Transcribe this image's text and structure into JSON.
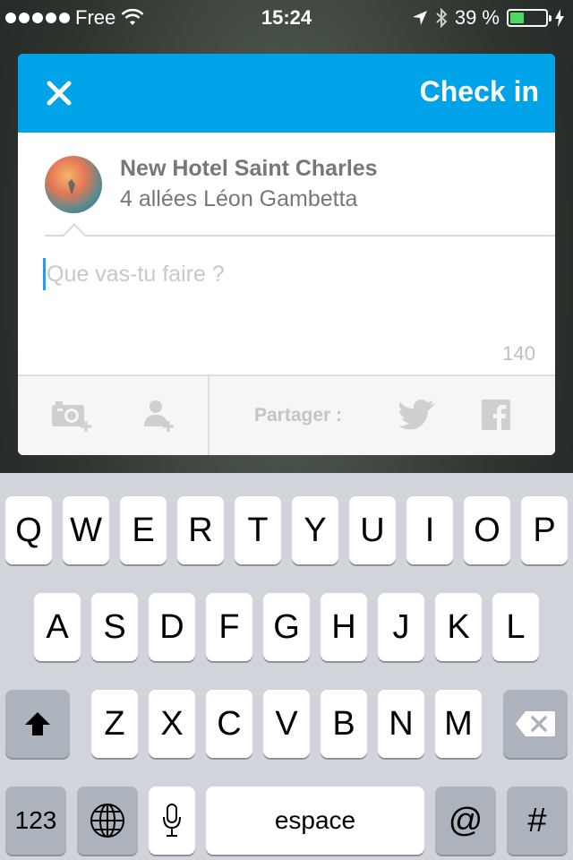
{
  "status_bar": {
    "carrier": "Free",
    "time": "15:24",
    "battery": "39 %",
    "battery_level": 0.39
  },
  "dialog": {
    "action_label": "Check in",
    "venue": {
      "name": "New Hotel Saint Charles",
      "address": "4 allées Léon Gambetta"
    },
    "compose": {
      "value": "",
      "placeholder": "Que vas-tu faire ?",
      "char_count": "140"
    },
    "toolbar": {
      "share_label": "Partager :"
    }
  },
  "keyboard": {
    "row1": [
      "Q",
      "W",
      "E",
      "R",
      "T",
      "Y",
      "U",
      "I",
      "O",
      "P"
    ],
    "row2": [
      "A",
      "S",
      "D",
      "F",
      "G",
      "H",
      "J",
      "K",
      "L"
    ],
    "row3": [
      "Z",
      "X",
      "C",
      "V",
      "B",
      "N",
      "M"
    ],
    "numbers_key": "123",
    "space_key": "espace",
    "at_key": "@",
    "hash_key": "#"
  },
  "colors": {
    "accent": "#00a3e8",
    "battery_green": "#4cd964"
  }
}
